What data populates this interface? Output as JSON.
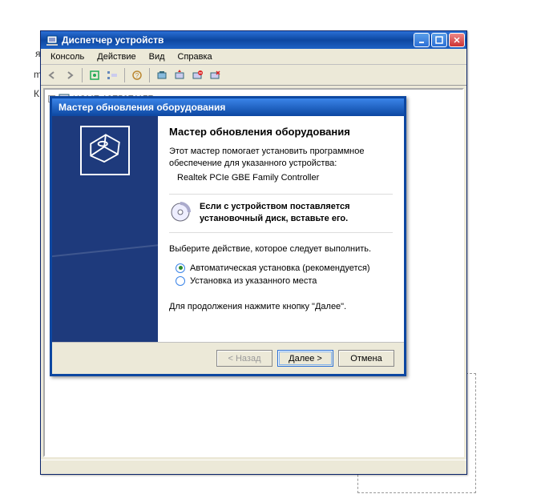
{
  "bg": {
    "c1": "я",
    "c2": "m",
    "c3": "К"
  },
  "device_manager": {
    "title": "Диспетчер устройств",
    "menu": {
      "console": "Консоль",
      "action": "Действие",
      "view": "Вид",
      "help": "Справка"
    },
    "tree": {
      "root": "HOME-12E56E117F"
    }
  },
  "wizard": {
    "title": "Мастер обновления оборудования",
    "heading": "Мастер обновления оборудования",
    "desc": "Этот мастер помогает установить программное обеспечение для указанного устройства:",
    "device": "Realtek PCIe GBE Family Controller",
    "cd_prompt": "Если с устройством поставляется установочный диск, вставьте его.",
    "select_prompt": "Выберите действие, которое следует выполнить.",
    "radio": {
      "auto": "Автоматическая установка (рекомендуется)",
      "manual": "Установка из указанного места"
    },
    "continue_hint": "Для продолжения нажмите кнопку \"Далее\".",
    "buttons": {
      "back": "< Назад",
      "next": "Далее >",
      "cancel": "Отмена"
    }
  }
}
